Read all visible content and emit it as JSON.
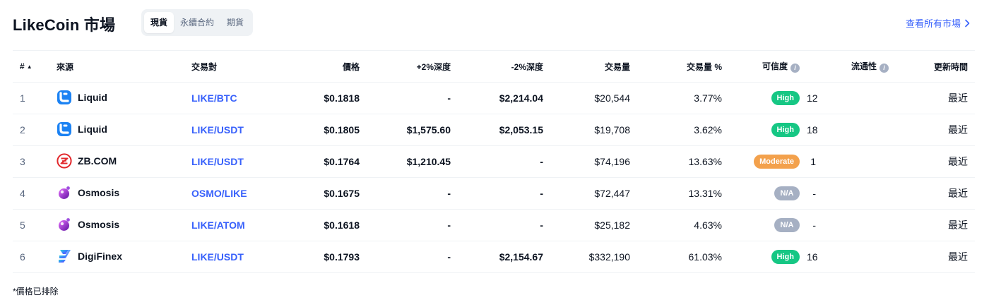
{
  "header": {
    "title": "LikeCoin 市場",
    "tabs": [
      {
        "label": "現貨",
        "active": true
      },
      {
        "label": "永續合約",
        "active": false
      },
      {
        "label": "期貨",
        "active": false
      }
    ],
    "view_all": "查看所有市場"
  },
  "table": {
    "columns": {
      "rank": "#",
      "source": "來源",
      "pair": "交易對",
      "price": "價格",
      "depth_plus": "+2%深度",
      "depth_minus": "-2%深度",
      "volume": "交易量",
      "volume_pct": "交易量 %",
      "confidence": "可信度",
      "liquidity": "流通性",
      "updated": "更新時間"
    },
    "rows": [
      {
        "rank": "1",
        "source": "Liquid",
        "logo": "liquid-logo-icon",
        "pair": "LIKE/BTC",
        "price": "$0.1818",
        "depth_plus": "-",
        "depth_minus": "$2,214.04",
        "volume": "$20,544",
        "volume_pct": "3.77%",
        "confidence": "High",
        "liquidity": "12",
        "updated": "最近"
      },
      {
        "rank": "2",
        "source": "Liquid",
        "logo": "liquid-logo-icon",
        "pair": "LIKE/USDT",
        "price": "$0.1805",
        "depth_plus": "$1,575.60",
        "depth_minus": "$2,053.15",
        "volume": "$19,708",
        "volume_pct": "3.62%",
        "confidence": "High",
        "liquidity": "18",
        "updated": "最近"
      },
      {
        "rank": "3",
        "source": "ZB.COM",
        "logo": "zb-logo-icon",
        "pair": "LIKE/USDT",
        "price": "$0.1764",
        "depth_plus": "$1,210.45",
        "depth_minus": "-",
        "volume": "$74,196",
        "volume_pct": "13.63%",
        "confidence": "Moderate",
        "liquidity": "1",
        "updated": "最近"
      },
      {
        "rank": "4",
        "source": "Osmosis",
        "logo": "osmosis-logo-icon",
        "pair": "OSMO/LIKE",
        "price": "$0.1675",
        "depth_plus": "-",
        "depth_minus": "-",
        "volume": "$72,447",
        "volume_pct": "13.31%",
        "confidence": "N/A",
        "liquidity": "-",
        "updated": "最近"
      },
      {
        "rank": "5",
        "source": "Osmosis",
        "logo": "osmosis-logo-icon",
        "pair": "LIKE/ATOM",
        "price": "$0.1618",
        "depth_plus": "-",
        "depth_minus": "-",
        "volume": "$25,182",
        "volume_pct": "4.63%",
        "confidence": "N/A",
        "liquidity": "-",
        "updated": "最近"
      },
      {
        "rank": "6",
        "source": "DigiFinex",
        "logo": "digifinex-logo-icon",
        "pair": "LIKE/USDT",
        "price": "$0.1793",
        "depth_plus": "-",
        "depth_minus": "$2,154.67",
        "volume": "$332,190",
        "volume_pct": "61.03%",
        "confidence": "High",
        "liquidity": "16",
        "updated": "最近"
      }
    ]
  },
  "colors": {
    "accent": "#3861fb",
    "high": "#16c784",
    "moderate": "#f3a14c",
    "na": "#a6b0c3"
  },
  "footnote": "*價格已排除"
}
